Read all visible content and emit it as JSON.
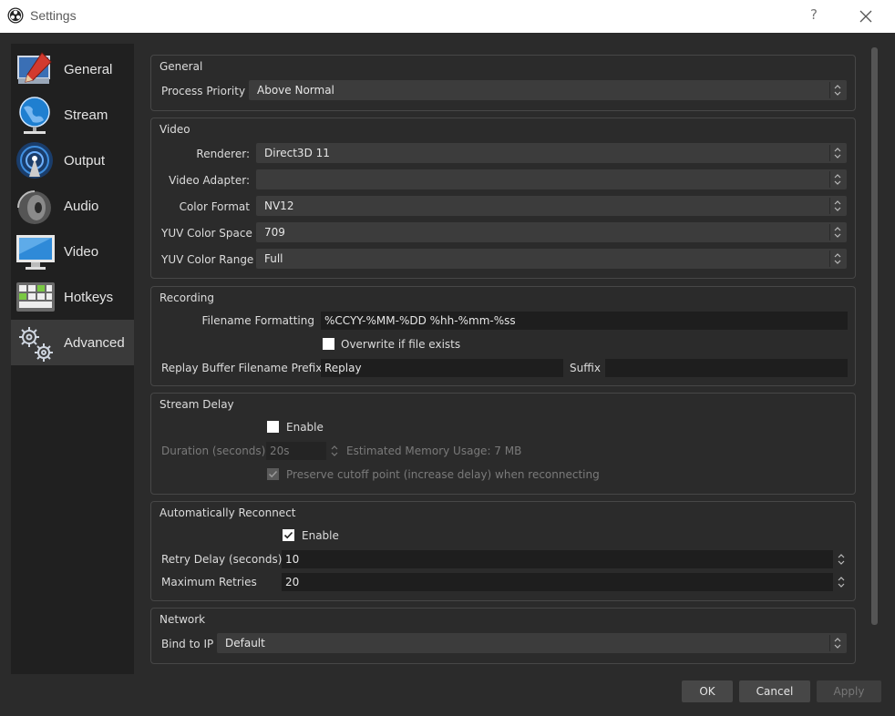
{
  "window": {
    "title": "Settings",
    "help": "?"
  },
  "sidebar": {
    "items": [
      {
        "label": "General",
        "icon": "general-icon"
      },
      {
        "label": "Stream",
        "icon": "globe-icon"
      },
      {
        "label": "Output",
        "icon": "broadcast-icon"
      },
      {
        "label": "Audio",
        "icon": "speaker-icon"
      },
      {
        "label": "Video",
        "icon": "monitor-icon"
      },
      {
        "label": "Hotkeys",
        "icon": "keyboard-icon"
      },
      {
        "label": "Advanced",
        "icon": "gears-icon"
      }
    ],
    "selected": "Advanced"
  },
  "general": {
    "title": "General",
    "process_priority_label": "Process Priority",
    "process_priority_value": "Above Normal"
  },
  "video": {
    "title": "Video",
    "renderer_label": "Renderer:",
    "renderer_value": "Direct3D 11",
    "adapter_label": "Video Adapter:",
    "adapter_value": "",
    "color_format_label": "Color Format",
    "color_format_value": "NV12",
    "yuv_space_label": "YUV Color Space",
    "yuv_space_value": "709",
    "yuv_range_label": "YUV Color Range",
    "yuv_range_value": "Full"
  },
  "recording": {
    "title": "Recording",
    "filename_label": "Filename Formatting",
    "filename_value": "%CCYY-%MM-%DD %hh-%mm-%ss",
    "overwrite_label": "Overwrite if file exists",
    "overwrite_checked": false,
    "replay_prefix_label": "Replay Buffer Filename Prefix",
    "replay_prefix_value": "Replay",
    "suffix_label": "Suffix",
    "suffix_value": ""
  },
  "stream_delay": {
    "title": "Stream Delay",
    "enable_label": "Enable",
    "enable_checked": false,
    "duration_label": "Duration (seconds)",
    "duration_value": "20s",
    "memory_label": "Estimated Memory Usage: 7 MB",
    "preserve_label": "Preserve cutoff point (increase delay) when reconnecting",
    "preserve_checked": true
  },
  "reconnect": {
    "title": "Automatically Reconnect",
    "enable_label": "Enable",
    "enable_checked": true,
    "retry_delay_label": "Retry Delay (seconds)",
    "retry_delay_value": "10",
    "max_retries_label": "Maximum Retries",
    "max_retries_value": "20"
  },
  "network": {
    "title": "Network",
    "bind_label": "Bind to IP",
    "bind_value": "Default"
  },
  "buttons": {
    "ok": "OK",
    "cancel": "Cancel",
    "apply": "Apply"
  }
}
